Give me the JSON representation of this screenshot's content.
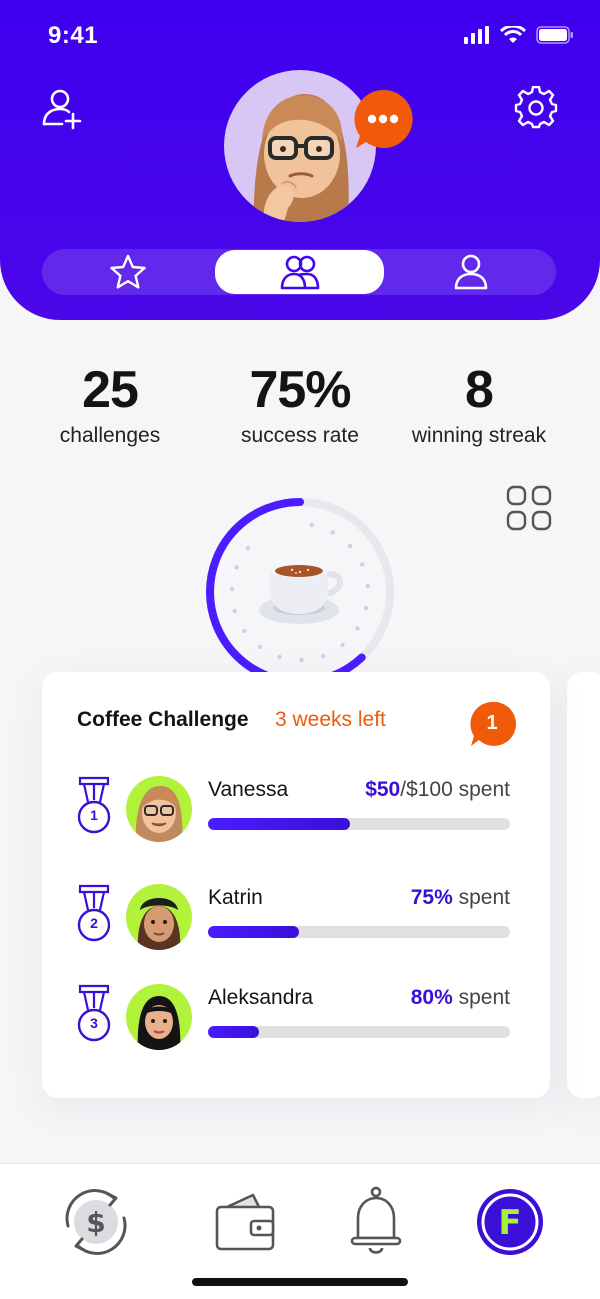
{
  "status": {
    "time": "9:41"
  },
  "header": {
    "icons": [
      "add-user-icon",
      "gear-icon",
      "chat-bubble-icon"
    ],
    "segments": [
      {
        "icon": "star-icon",
        "active": false
      },
      {
        "icon": "friends-icon",
        "active": true
      },
      {
        "icon": "person-icon",
        "active": false
      }
    ],
    "accent": "#4406ee"
  },
  "stats": [
    {
      "value": "25",
      "label": "challenges"
    },
    {
      "value": "75%",
      "label": "success rate"
    },
    {
      "value": "8",
      "label": "winning streak"
    }
  ],
  "progress_ring": {
    "icon": "coffee-cup-icon",
    "fraction": 0.62
  },
  "challenge": {
    "title": "Coffee Challenge",
    "time_left": "3 weeks left",
    "badge": "1",
    "participants": [
      {
        "rank": "1",
        "name": "Vanessa",
        "amount": "$50",
        "rest": "/$100 spent",
        "progress": 0.47
      },
      {
        "rank": "2",
        "name": "Katrin",
        "amount": "75%",
        "rest": " spent",
        "progress": 0.3
      },
      {
        "rank": "3",
        "name": "Aleksandra",
        "amount": "80%",
        "rest": " spent",
        "progress": 0.17
      }
    ]
  },
  "tabbar": {
    "tabs": [
      "dollar-exchange-icon",
      "wallet-icon",
      "bell-icon",
      "profile-f-icon"
    ],
    "active_letter": "F"
  },
  "colors": {
    "accent": "#3a0fd8",
    "orange": "#f05a0a",
    "lime": "#b3f23b"
  }
}
